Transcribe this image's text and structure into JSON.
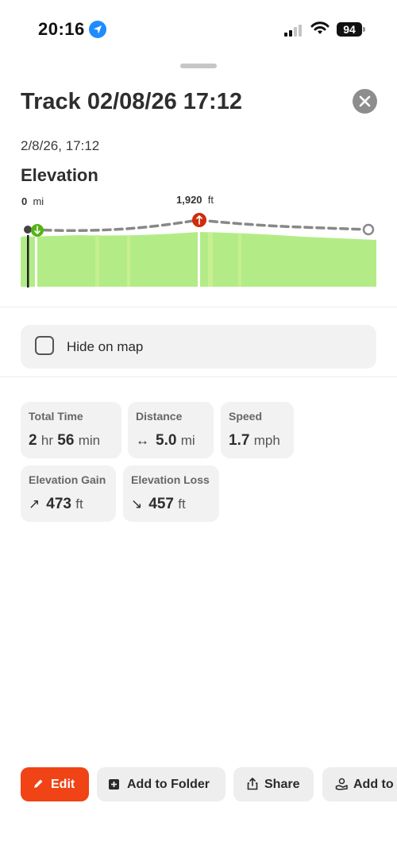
{
  "status_bar": {
    "time": "20:16",
    "battery": "94"
  },
  "sheet": {
    "title": "Track 02/08/26 17:12",
    "subtitle": "2/8/26, 17:12",
    "elevation_heading": "Elevation",
    "elevation": {
      "start_distance_value": "0",
      "start_distance_unit": "mi",
      "peak_value": "1,920",
      "peak_unit": "ft",
      "profile_color": "#b3ec87",
      "start_marker_color": "#55b315",
      "peak_marker_color": "#cf2d0e"
    },
    "hide_on_map": {
      "label": "Hide on map",
      "checked": false
    },
    "stats": [
      {
        "label": "Total Time",
        "value1": "2",
        "unit1": "hr",
        "value2": "56",
        "unit2": "min"
      },
      {
        "label": "Distance",
        "icon": "horizontal-arrows-icon",
        "value": "5.0",
        "unit": "mi"
      },
      {
        "label": "Speed",
        "value": "1.7",
        "unit": "mph"
      },
      {
        "label": "Elevation Gain",
        "icon": "arrow-up-right-icon",
        "value": "473",
        "unit": "ft"
      },
      {
        "label": "Elevation Loss",
        "icon": "arrow-down-right-icon",
        "value": "457",
        "unit": "ft"
      }
    ],
    "actions": {
      "edit": "Edit",
      "add_to_folder": "Add to Folder",
      "share": "Share",
      "add_to": "Add to"
    },
    "accent_color": "#f04316"
  }
}
